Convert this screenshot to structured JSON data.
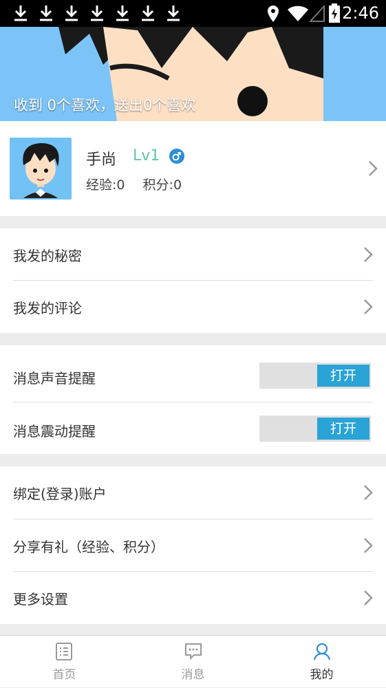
{
  "statusbar": {
    "time": "2:46"
  },
  "banner": {
    "text": "收到 0个喜欢，送出0个喜欢"
  },
  "profile": {
    "name": "手尚",
    "level": "Lv1",
    "experience": "经验:0",
    "points": "积分:0"
  },
  "menu1": [
    {
      "label": "我发的秘密"
    },
    {
      "label": "我发的评论"
    }
  ],
  "toggles": [
    {
      "label": "消息声音提醒",
      "state": "打开"
    },
    {
      "label": "消息震动提醒",
      "state": "打开"
    }
  ],
  "menu2": [
    {
      "label": "绑定(登录)账户"
    },
    {
      "label": "分享有礼（经验、积分）"
    },
    {
      "label": "更多设置"
    }
  ],
  "tabs": [
    {
      "label": "首页"
    },
    {
      "label": "消息"
    },
    {
      "label": "我的"
    }
  ],
  "colors": {
    "accent": "#2aa3d6",
    "banner": "#7cc4f7",
    "level": "#5cc7a5"
  }
}
